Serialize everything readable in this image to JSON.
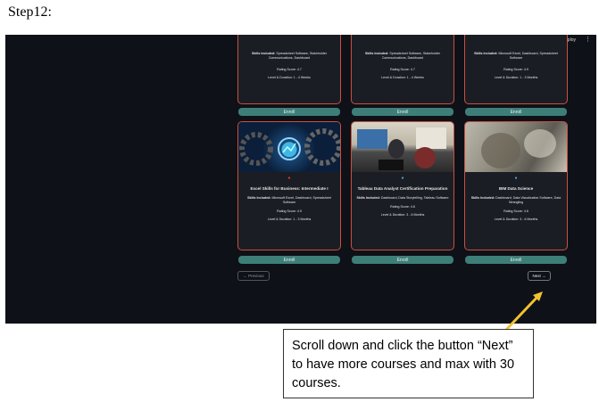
{
  "step_label": "Step12:",
  "app": {
    "deploy_label": "Deploy",
    "menu_icon": "kebab-menu-icon"
  },
  "top_row": [
    {
      "skills_prefix": "Skills Included:",
      "skills": "Spreadsheet Software, Stakeholder Communications, Dashboard",
      "rating": "Rating Score: 4.7",
      "level": "Level & Duration: 1 - 4 Weeks"
    },
    {
      "skills_prefix": "Skills Included:",
      "skills": "Spreadsheet Software, Stakeholder Communications, Dashboard",
      "rating": "Rating Score: 4.7",
      "level": "Level & Duration: 1 - 4 Weeks"
    },
    {
      "skills_prefix": "Skills Included:",
      "skills": "Microsoft Excel, Dashboard, Spreadsheet Software",
      "rating": "Rating Score: 4.9",
      "level": "Level & Duration: 1 - 3 Months"
    }
  ],
  "bottom_row": [
    {
      "title": "Excel Skills for Business: Intermediate I",
      "skills_prefix": "Skills Included:",
      "skills": "Microsoft Excel, Dashboard, Spreadsheet Software",
      "rating": "Rating Score: 4.9",
      "level": "Level & Duration: 1 - 3 Months"
    },
    {
      "title": "Tableau Data Analyst Certification Preparation",
      "skills_prefix": "Skills Included:",
      "skills": "Dashboard, Data Storytelling, Tableau Software",
      "rating": "Rating Score: 4.6",
      "level": "Level & Duration: 3 - 6 Months"
    },
    {
      "title": "IBM Data Science",
      "skills_prefix": "Skills Included:",
      "skills": "Dashboard, Data Visualization Software, Data Wrangling",
      "rating": "Rating Score: 4.6",
      "level": "Level & Duration: 3 - 6 Months"
    }
  ],
  "enroll_label": "Enroll",
  "pagination": {
    "previous_label": "← Previous",
    "next_label": "Next →"
  },
  "callout": {
    "text": "Scroll down and click the button “Next” to have more courses and max with 30 courses."
  },
  "colors": {
    "card_border": "#c9503f",
    "enroll_bg": "#3e7e79",
    "arrow": "#f2c230"
  }
}
